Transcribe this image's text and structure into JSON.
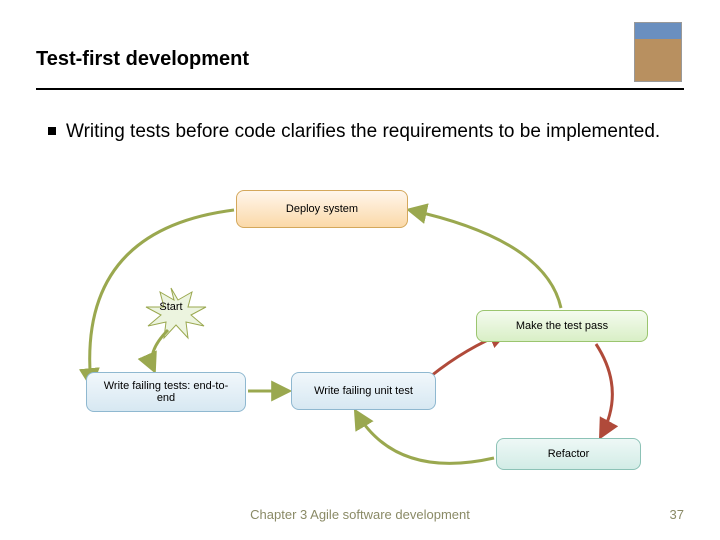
{
  "title": "Test-first development",
  "bullet": "Writing tests before code clarifies the requirements to be implemented.",
  "nodes": {
    "deploy": "Deploy system",
    "start": "Start",
    "make_pass": "Make the test pass",
    "write_e2e": "Write failing tests: end-to-end",
    "write_unit": "Write failing unit test",
    "refactor": "Refactor"
  },
  "footer": "Chapter 3 Agile software development",
  "page_number": "37",
  "colors": {
    "olive_arrow": "#9aa84f",
    "red_arrow": "#b04a3a",
    "footer_text": "#8a8a66"
  }
}
